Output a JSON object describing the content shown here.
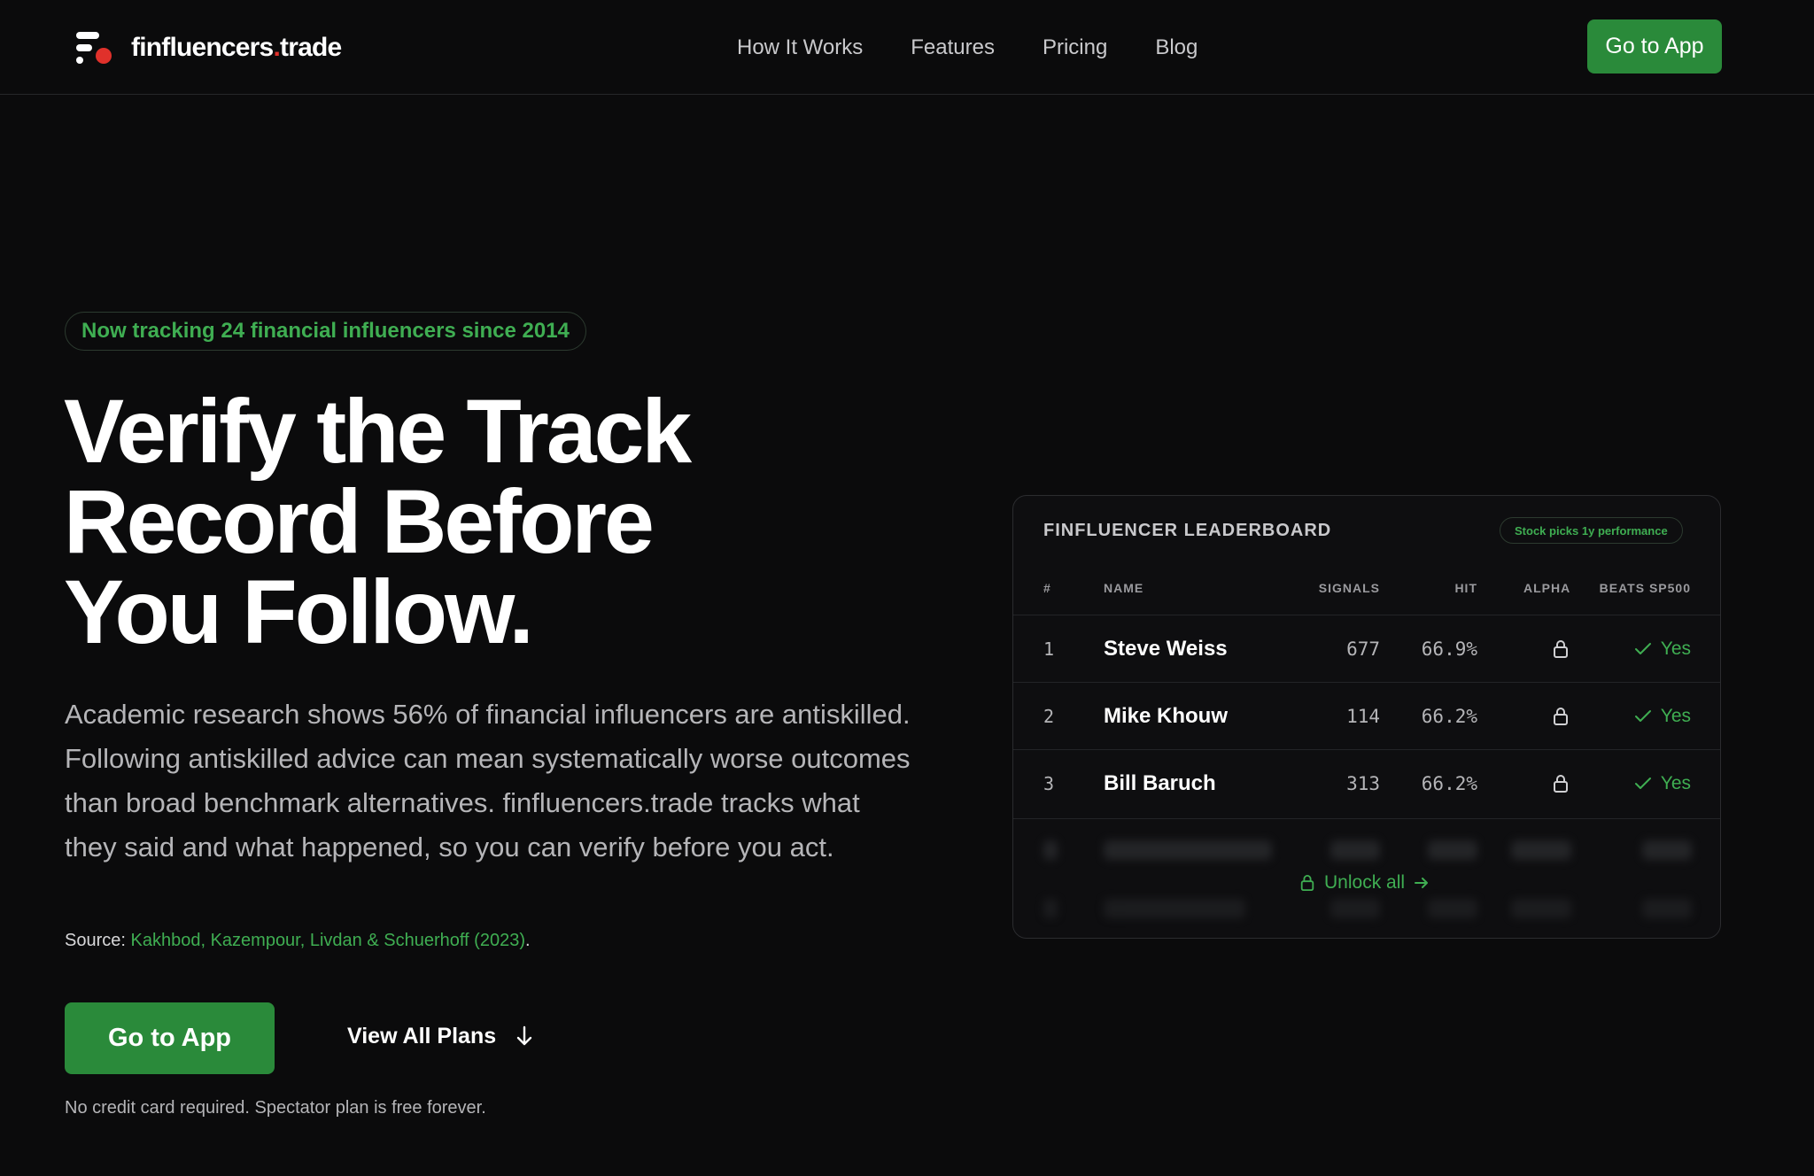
{
  "nav": {
    "brand_main": "finfluencers",
    "brand_dot": ".",
    "brand_tld": "trade",
    "links": [
      "How It Works",
      "Features",
      "Pricing",
      "Blog"
    ],
    "cta": "Go to App"
  },
  "hero": {
    "badge": "Now tracking 24 financial influencers since 2014",
    "headline": [
      "Verify the Track",
      "Record Before",
      "You Follow."
    ],
    "paragraph": "Academic research shows 56% of financial influencers are antiskilled. Following antiskilled advice can mean systematically worse outcomes than broad benchmark alternatives. finfluencers.trade tracks what they said and what happened, so you can verify before you act.",
    "source_label": "Source:",
    "source_link": "Kakhbod, Kazempour, Livdan & Schuerhoff (2023)",
    "source_end": ".",
    "cta": "Go to App",
    "secondary_cta": "View All Plans",
    "note": "No credit card required. Spectator plan is free forever."
  },
  "leaderboard": {
    "title": "FINFLUENCER LEADERBOARD",
    "pill": "Stock picks 1y performance",
    "columns": [
      "#",
      "NAME",
      "SIGNALS",
      "HIT",
      "ALPHA",
      "BEATS SP500"
    ],
    "rows": [
      {
        "rank": "1",
        "name": "Steve Weiss",
        "signals": "677",
        "hit": "66.9%",
        "beats": "Yes"
      },
      {
        "rank": "2",
        "name": "Mike Khouw",
        "signals": "114",
        "hit": "66.2%",
        "beats": "Yes"
      },
      {
        "rank": "3",
        "name": "Bill Baruch",
        "signals": "313",
        "hit": "66.2%",
        "beats": "Yes"
      }
    ],
    "unlock": "Unlock all"
  },
  "colors": {
    "accent_green": "#2a8a3a",
    "text_green": "#3fae52",
    "brand_red": "#e0312b",
    "background": "#0b0b0c"
  }
}
